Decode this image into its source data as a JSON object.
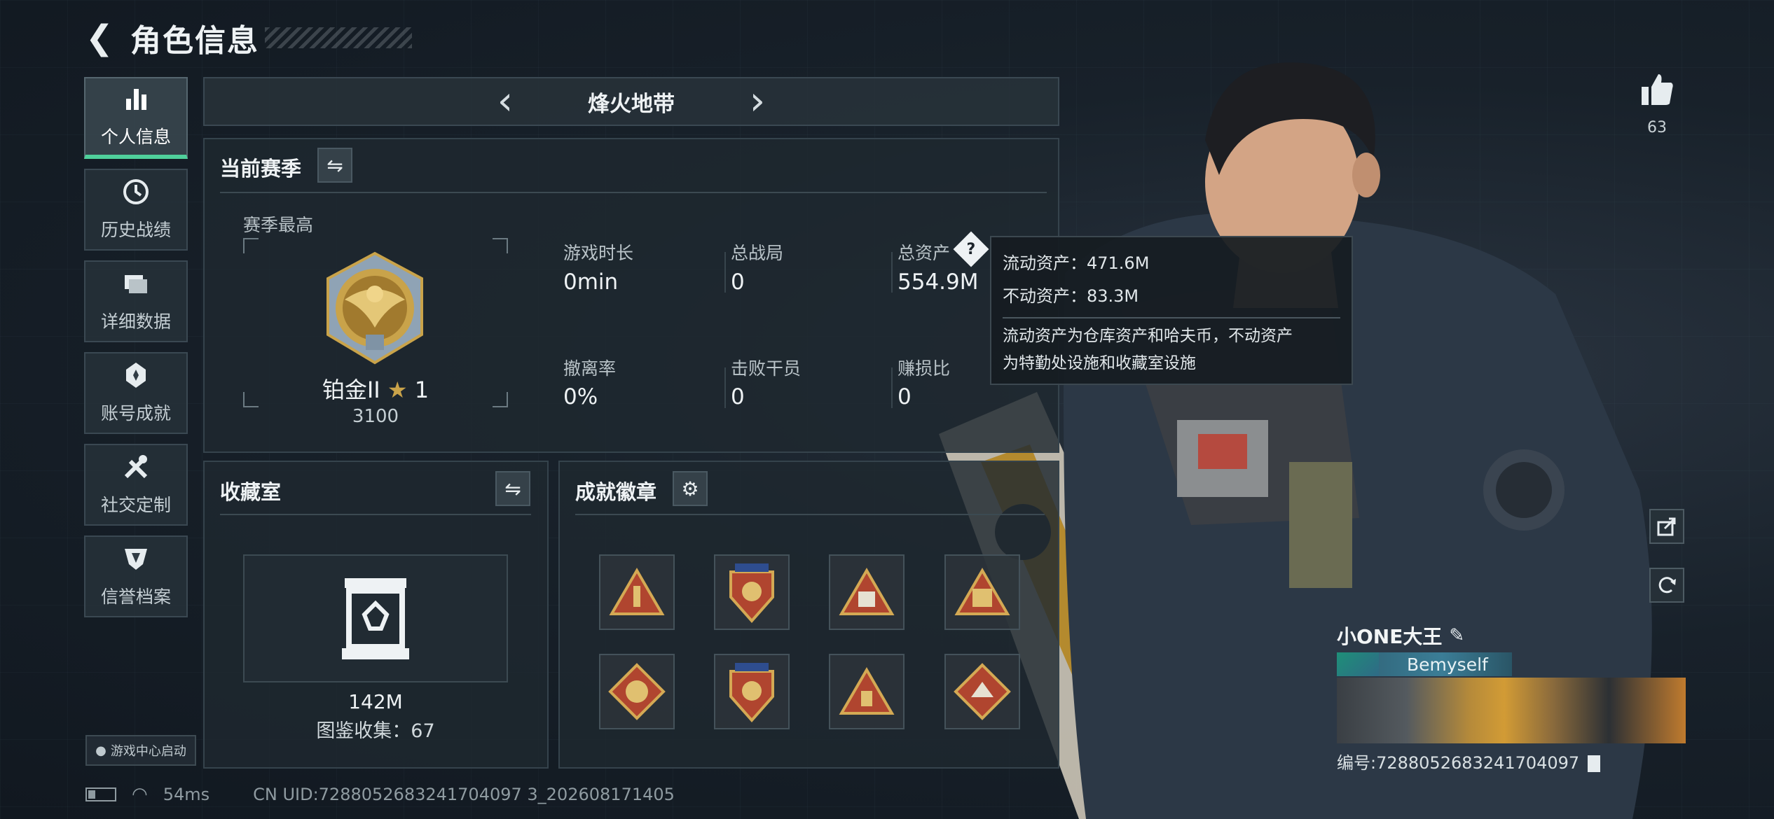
{
  "header": {
    "title": "角色信息"
  },
  "sidebar": {
    "items": [
      {
        "label": "个人信息",
        "icon": "bar-chart-icon",
        "active": true
      },
      {
        "label": "历史战绩",
        "icon": "clock-icon"
      },
      {
        "label": "详细数据",
        "icon": "folder-icon"
      },
      {
        "label": "账号成就",
        "icon": "achievement-icon"
      },
      {
        "label": "社交定制",
        "icon": "tools-icon"
      },
      {
        "label": "信誉档案",
        "icon": "credit-shield-icon"
      }
    ],
    "launcher": "游戏中心启动"
  },
  "mode": {
    "name": "烽火地带"
  },
  "season": {
    "title": "当前赛季",
    "best_label": "赛季最高",
    "rank": "铂金II",
    "stars": "1",
    "score": "3100",
    "stats": [
      {
        "label": "游戏时长",
        "value": "0min"
      },
      {
        "label": "总战局",
        "value": "0"
      },
      {
        "label": "总资产",
        "value": "554.9M"
      },
      {
        "label": "撤离率",
        "value": "0%"
      },
      {
        "label": "击败干员",
        "value": "0"
      },
      {
        "label": "赚损比",
        "value": "0"
      }
    ]
  },
  "tooltip": {
    "liquid": "流动资产：471.6M",
    "fixed": "不动资产：83.3M",
    "desc1": "流动资产为仓库资产和哈夫币，不动资产",
    "desc2": "为特勤处设施和收藏室设施"
  },
  "collection": {
    "title": "收藏室",
    "value": "142M",
    "catalog": "图鉴收集：67"
  },
  "achievements": {
    "title": "成就徽章",
    "badges": [
      "badge-triangle-rocket",
      "badge-shield-star",
      "badge-triangle-58",
      "badge-triangle-building",
      "badge-diamond-beast",
      "badge-shield-star-2",
      "badge-triangle-pyramid",
      "badge-diamond-dog"
    ]
  },
  "profile": {
    "likes": "63",
    "name": "小ONE大王",
    "tag": "Bemyself",
    "id": "编号:7288052683241704097"
  },
  "status": {
    "ping": "54ms",
    "uid": "CN UID:7288052683241704097 3_202608171405"
  },
  "colors": {
    "accent": "#4fd09b",
    "gold": "#c9a34a"
  }
}
